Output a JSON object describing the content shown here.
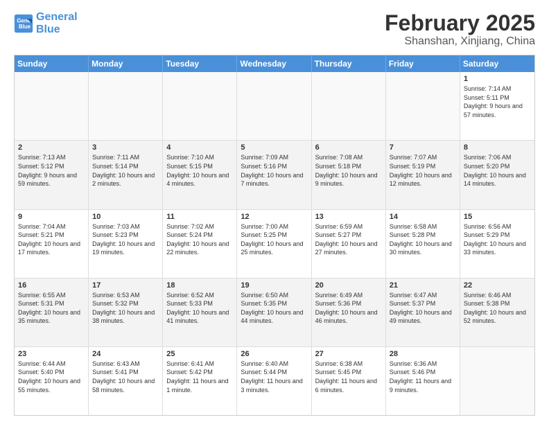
{
  "header": {
    "logo_line1": "General",
    "logo_line2": "Blue",
    "month": "February 2025",
    "location": "Shanshan, Xinjiang, China"
  },
  "days_of_week": [
    "Sunday",
    "Monday",
    "Tuesday",
    "Wednesday",
    "Thursday",
    "Friday",
    "Saturday"
  ],
  "weeks": [
    [
      {
        "day": "",
        "empty": true
      },
      {
        "day": "",
        "empty": true
      },
      {
        "day": "",
        "empty": true
      },
      {
        "day": "",
        "empty": true
      },
      {
        "day": "",
        "empty": true
      },
      {
        "day": "",
        "empty": true
      },
      {
        "day": "1",
        "info": "Sunrise: 7:14 AM\nSunset: 5:11 PM\nDaylight: 9 hours\nand 57 minutes."
      }
    ],
    [
      {
        "day": "2",
        "info": "Sunrise: 7:13 AM\nSunset: 5:12 PM\nDaylight: 9 hours\nand 59 minutes."
      },
      {
        "day": "3",
        "info": "Sunrise: 7:11 AM\nSunset: 5:14 PM\nDaylight: 10 hours\nand 2 minutes."
      },
      {
        "day": "4",
        "info": "Sunrise: 7:10 AM\nSunset: 5:15 PM\nDaylight: 10 hours\nand 4 minutes."
      },
      {
        "day": "5",
        "info": "Sunrise: 7:09 AM\nSunset: 5:16 PM\nDaylight: 10 hours\nand 7 minutes."
      },
      {
        "day": "6",
        "info": "Sunrise: 7:08 AM\nSunset: 5:18 PM\nDaylight: 10 hours\nand 9 minutes."
      },
      {
        "day": "7",
        "info": "Sunrise: 7:07 AM\nSunset: 5:19 PM\nDaylight: 10 hours\nand 12 minutes."
      },
      {
        "day": "8",
        "info": "Sunrise: 7:06 AM\nSunset: 5:20 PM\nDaylight: 10 hours\nand 14 minutes."
      }
    ],
    [
      {
        "day": "9",
        "info": "Sunrise: 7:04 AM\nSunset: 5:21 PM\nDaylight: 10 hours\nand 17 minutes."
      },
      {
        "day": "10",
        "info": "Sunrise: 7:03 AM\nSunset: 5:23 PM\nDaylight: 10 hours\nand 19 minutes."
      },
      {
        "day": "11",
        "info": "Sunrise: 7:02 AM\nSunset: 5:24 PM\nDaylight: 10 hours\nand 22 minutes."
      },
      {
        "day": "12",
        "info": "Sunrise: 7:00 AM\nSunset: 5:25 PM\nDaylight: 10 hours\nand 25 minutes."
      },
      {
        "day": "13",
        "info": "Sunrise: 6:59 AM\nSunset: 5:27 PM\nDaylight: 10 hours\nand 27 minutes."
      },
      {
        "day": "14",
        "info": "Sunrise: 6:58 AM\nSunset: 5:28 PM\nDaylight: 10 hours\nand 30 minutes."
      },
      {
        "day": "15",
        "info": "Sunrise: 6:56 AM\nSunset: 5:29 PM\nDaylight: 10 hours\nand 33 minutes."
      }
    ],
    [
      {
        "day": "16",
        "info": "Sunrise: 6:55 AM\nSunset: 5:31 PM\nDaylight: 10 hours\nand 35 minutes."
      },
      {
        "day": "17",
        "info": "Sunrise: 6:53 AM\nSunset: 5:32 PM\nDaylight: 10 hours\nand 38 minutes."
      },
      {
        "day": "18",
        "info": "Sunrise: 6:52 AM\nSunset: 5:33 PM\nDaylight: 10 hours\nand 41 minutes."
      },
      {
        "day": "19",
        "info": "Sunrise: 6:50 AM\nSunset: 5:35 PM\nDaylight: 10 hours\nand 44 minutes."
      },
      {
        "day": "20",
        "info": "Sunrise: 6:49 AM\nSunset: 5:36 PM\nDaylight: 10 hours\nand 46 minutes."
      },
      {
        "day": "21",
        "info": "Sunrise: 6:47 AM\nSunset: 5:37 PM\nDaylight: 10 hours\nand 49 minutes."
      },
      {
        "day": "22",
        "info": "Sunrise: 6:46 AM\nSunset: 5:38 PM\nDaylight: 10 hours\nand 52 minutes."
      }
    ],
    [
      {
        "day": "23",
        "info": "Sunrise: 6:44 AM\nSunset: 5:40 PM\nDaylight: 10 hours\nand 55 minutes."
      },
      {
        "day": "24",
        "info": "Sunrise: 6:43 AM\nSunset: 5:41 PM\nDaylight: 10 hours\nand 58 minutes."
      },
      {
        "day": "25",
        "info": "Sunrise: 6:41 AM\nSunset: 5:42 PM\nDaylight: 11 hours\nand 1 minute."
      },
      {
        "day": "26",
        "info": "Sunrise: 6:40 AM\nSunset: 5:44 PM\nDaylight: 11 hours\nand 3 minutes."
      },
      {
        "day": "27",
        "info": "Sunrise: 6:38 AM\nSunset: 5:45 PM\nDaylight: 11 hours\nand 6 minutes."
      },
      {
        "day": "28",
        "info": "Sunrise: 6:36 AM\nSunset: 5:46 PM\nDaylight: 11 hours\nand 9 minutes."
      },
      {
        "day": "",
        "empty": true
      }
    ]
  ]
}
